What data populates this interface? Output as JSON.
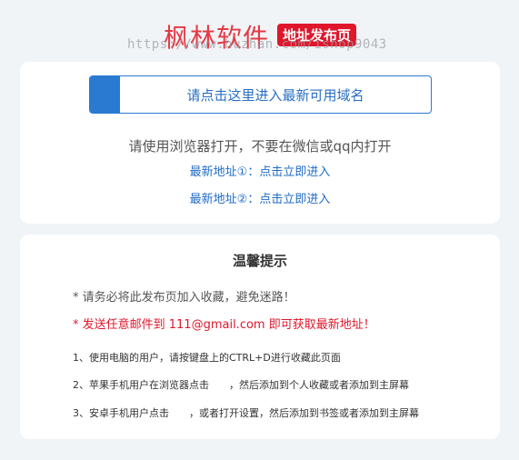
{
  "header": {
    "brand": "枫林软件",
    "badge": "地址发布页",
    "watermark": "https://www.huzhan.com/ishop9043"
  },
  "access_card": {
    "cta_label": "请点击这里进入最新可用域名",
    "browser_tip": "请使用浏览器打开，不要在微信或qq内打开",
    "link1": "最新地址①：点击立即进入",
    "link2": "最新地址②：点击立即进入"
  },
  "notice_card": {
    "title": "温馨提示",
    "note1": "* 请务必将此发布页加入收藏，避免迷路！",
    "note2": "* 发送任意邮件到 111@gmail.com 即可获取最新地址！",
    "steps": [
      "1、使用电脑的用户，请按键盘上的CTRL+D进行收藏此页面",
      "2、苹果手机用户在浏览器点击　　，然后添加到个人收藏或者添加到主屏幕",
      "3、安卓手机用户点击　　，或者打开设置，然后添加到书签或者添加到主屏幕"
    ]
  },
  "colors": {
    "accent": "#2a7ad2",
    "brand_red": "#e0162b",
    "background": "#f1f4f7"
  }
}
